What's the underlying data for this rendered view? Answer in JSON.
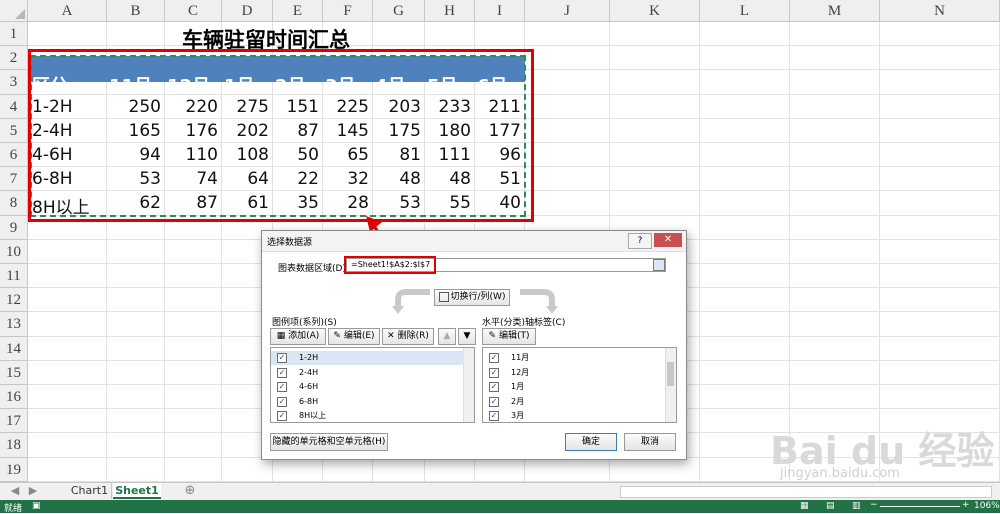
{
  "sheet": {
    "columns": [
      "A",
      "B",
      "C",
      "D",
      "E",
      "F",
      "G",
      "H",
      "I",
      "J",
      "K",
      "L",
      "M",
      "N"
    ],
    "rows": [
      "1",
      "2",
      "3",
      "4",
      "5",
      "6",
      "7",
      "8",
      "9",
      "10",
      "11",
      "12",
      "13",
      "14",
      "15",
      "16",
      "17",
      "18",
      "19"
    ],
    "title": "车辆驻留时间汇总",
    "table": {
      "header": [
        "区分",
        "11月",
        "12月",
        "1月",
        "2月",
        "3月",
        "4月",
        "5月",
        "6月"
      ],
      "rows": [
        [
          "1-2H",
          "250",
          "220",
          "275",
          "151",
          "225",
          "203",
          "233",
          "211"
        ],
        [
          "2-4H",
          "165",
          "176",
          "202",
          "87",
          "145",
          "175",
          "180",
          "177"
        ],
        [
          "4-6H",
          "94",
          "110",
          "108",
          "50",
          "65",
          "81",
          "111",
          "96"
        ],
        [
          "6-8H",
          "53",
          "74",
          "64",
          "22",
          "32",
          "48",
          "48",
          "51"
        ],
        [
          "8H以上",
          "62",
          "87",
          "61",
          "35",
          "28",
          "53",
          "55",
          "40"
        ]
      ]
    }
  },
  "dialog": {
    "title": "选择数据源",
    "help": "?",
    "close": "✕",
    "range_label": "图表数据区域(D):",
    "range_value": "=Sheet1!$A$2:$I$7",
    "switch_label": "切换行/列(W)",
    "series_label": "图例项(系列)(S)",
    "add": "添加(A)",
    "edit": "编辑(E)",
    "remove": "删除(R)",
    "series": [
      "1-2H",
      "2-4H",
      "4-6H",
      "6-8H",
      "8H以上"
    ],
    "axis_label": "水平(分类)轴标签(C)",
    "axis_edit": "编辑(T)",
    "categories": [
      "11月",
      "12月",
      "1月",
      "2月",
      "3月"
    ],
    "hidden_cells": "隐藏的单元格和空单元格(H)",
    "ok": "确定",
    "cancel": "取消"
  },
  "tabs": [
    "Chart1",
    "Sheet1"
  ],
  "status": {
    "left": "就绪",
    "zoom": "106%"
  },
  "watermark": {
    "brand": "Bai du 经验",
    "url": "jingyan.baidu.com"
  }
}
